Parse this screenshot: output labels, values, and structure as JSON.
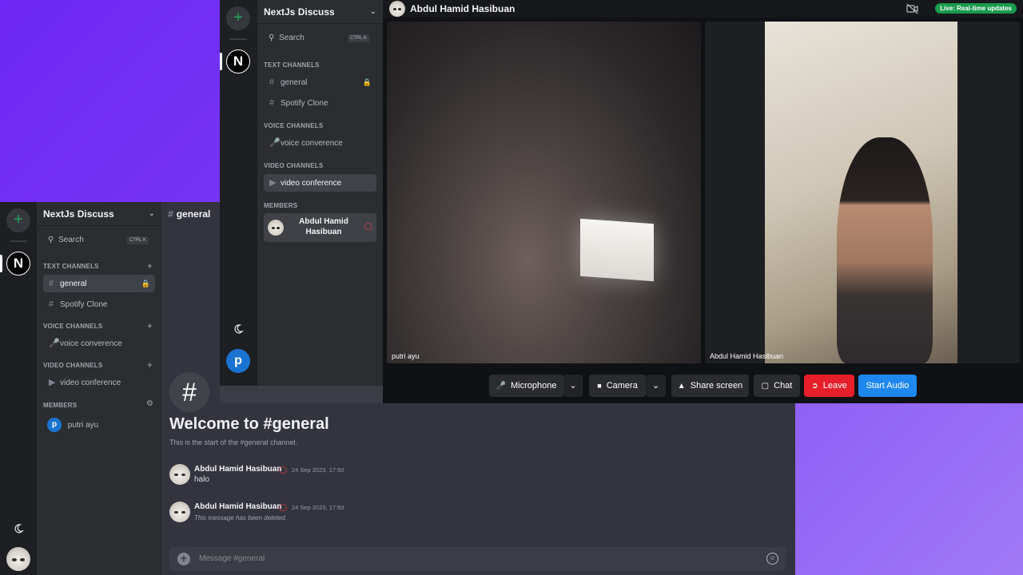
{
  "back": {
    "server_name": "NextJs Discuss",
    "search": {
      "label": "Search",
      "shortcut": "CTRL K"
    },
    "sections": {
      "text": "TEXT CHANNELS",
      "voice": "VOICE CHANNELS",
      "video": "VIDEO CHANNELS",
      "members": "MEMBERS"
    },
    "channels": {
      "general": "general",
      "spotify": "Spotify Clone",
      "voice": "voice converence",
      "video": "video conference"
    },
    "member": {
      "initial": "p",
      "name": "putri ayu"
    },
    "header_channel": "general",
    "welcome_title": "Welcome to #general",
    "welcome_sub": "This is the start of the #general channel.",
    "messages": [
      {
        "author": "Abdul Hamid Hasibuan",
        "time": "24 Sep 2023, 17:50",
        "text": "halo"
      },
      {
        "author": "Abdul Hamid Hasibuan",
        "time": "24 Sep 2023, 17:50",
        "text": "This message has been deleted."
      }
    ],
    "composer_placeholder": "Message #general"
  },
  "front": {
    "server_name": "NextJs Discuss",
    "search": {
      "label": "Search",
      "shortcut": "CTRL K"
    },
    "sections": {
      "text": "TEXT CHANNELS",
      "voice": "VOICE CHANNELS",
      "video": "VIDEO CHANNELS",
      "members": "MEMBERS"
    },
    "channels": {
      "general": "general",
      "spotify": "Spotify Clone",
      "voice": "voice converence",
      "video": "video conference"
    },
    "member_name": "Abdul Hamid Hasibuan",
    "user_initial": "p",
    "call_user": "Abdul Hamid Hasibuan",
    "live_badge": "Live: Real-time updates",
    "tiles": [
      {
        "name": "putri ayu"
      },
      {
        "name": "Abdul Hamid Hasibuan"
      }
    ],
    "controls": {
      "microphone": "Microphone",
      "camera": "Camera",
      "share": "Share screen",
      "chat": "Chat",
      "leave": "Leave",
      "start_audio": "Start Audio"
    }
  },
  "colors": {
    "accent_green": "#23a55a",
    "leave_red": "#e61f2b",
    "start_audio_blue": "#1e88f0",
    "live_green": "#1a9a4b",
    "background_purple": "#6d28f5"
  },
  "icons": [
    "plus-icon",
    "n-logo",
    "search-icon",
    "chevron-down-icon",
    "hash-icon",
    "lock-icon",
    "mic-icon",
    "video-icon",
    "gear-icon",
    "moon-icon",
    "shield-icon",
    "emoji-icon",
    "camera-off-icon",
    "share-screen-icon",
    "chat-icon",
    "leave-icon"
  ]
}
